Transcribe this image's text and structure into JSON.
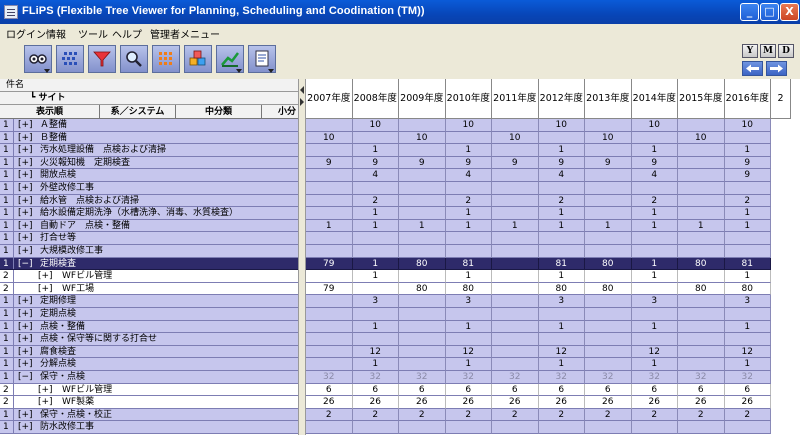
{
  "window": {
    "title": "FLiPS (Flexible Tree Viewer for Planning, Scheduling and Coodination (TM))",
    "buttons": {
      "minimize": "_",
      "maximize": "□",
      "close": "X"
    }
  },
  "menu": [
    "ログイン情報",
    "ツール",
    "ヘルプ",
    "管理者メニュー"
  ],
  "toolbar": {
    "icons": [
      "glasses-icon",
      "grid-dots-icon",
      "filter-icon",
      "search-icon",
      "orange-dots-icon",
      "cubes-icon",
      "green-chart-icon",
      "document-icon"
    ],
    "right_buttons": [
      "Y",
      "M",
      "D"
    ]
  },
  "header": {
    "item": "件名",
    "site": "┗ サイト",
    "cols": [
      "表示順",
      "系／システム",
      "中分類",
      "小分"
    ]
  },
  "years": [
    "2007年度",
    "2008年度",
    "2009年度",
    "2010年度",
    "2011年度",
    "2012年度",
    "2013年度",
    "2014年度",
    "2015年度",
    "2016年度",
    "2"
  ],
  "rows": [
    {
      "level": "1",
      "expand": "[+]",
      "name": "Ａ整備",
      "values": [
        "",
        "10",
        "",
        "10",
        "",
        "10",
        "",
        "10",
        "",
        "10"
      ],
      "style": "normal",
      "indent": 0
    },
    {
      "level": "1",
      "expand": "[+]",
      "name": "Ｂ整備",
      "values": [
        "10",
        "",
        "10",
        "",
        "10",
        "",
        "10",
        "",
        "10",
        ""
      ],
      "style": "normal",
      "indent": 0
    },
    {
      "level": "1",
      "expand": "[+]",
      "name": "汚水処理設備　点検および清掃",
      "values": [
        "",
        "1",
        "",
        "1",
        "",
        "1",
        "",
        "1",
        "",
        "1"
      ],
      "style": "normal",
      "indent": 0
    },
    {
      "level": "1",
      "expand": "[+]",
      "name": "火災報知機　定期検査",
      "values": [
        "9",
        "9",
        "9",
        "9",
        "9",
        "9",
        "9",
        "9",
        "",
        "9"
      ],
      "style": "normal",
      "indent": 0
    },
    {
      "level": "1",
      "expand": "[+]",
      "name": "開放点検",
      "values": [
        "",
        "4",
        "",
        "4",
        "",
        "4",
        "",
        "4",
        "",
        "9"
      ],
      "style": "normal",
      "indent": 0
    },
    {
      "level": "1",
      "expand": "[+]",
      "name": "外壁改修工事",
      "values": [
        "",
        "",
        "",
        "",
        "",
        "",
        "",
        "",
        "",
        ""
      ],
      "style": "normal",
      "indent": 0
    },
    {
      "level": "1",
      "expand": "[+]",
      "name": "給水管　点検および清掃",
      "values": [
        "",
        "2",
        "",
        "2",
        "",
        "2",
        "",
        "2",
        "",
        "2"
      ],
      "style": "normal",
      "indent": 0
    },
    {
      "level": "1",
      "expand": "[+]",
      "name": "給水設備定期洗浄（水槽洗浄、消毒、水質検査）",
      "values": [
        "",
        "1",
        "",
        "1",
        "",
        "1",
        "",
        "1",
        "",
        "1"
      ],
      "style": "normal",
      "indent": 0
    },
    {
      "level": "1",
      "expand": "[+]",
      "name": "自動ドア　点検・整備",
      "values": [
        "1",
        "1",
        "1",
        "1",
        "1",
        "1",
        "1",
        "1",
        "1",
        "1"
      ],
      "style": "normal",
      "indent": 0
    },
    {
      "level": "1",
      "expand": "[+]",
      "name": "打合せ等",
      "values": [
        "",
        "",
        "",
        "",
        "",
        "",
        "",
        "",
        "",
        ""
      ],
      "style": "normal",
      "indent": 0
    },
    {
      "level": "1",
      "expand": "[+]",
      "name": "大規模改修工事",
      "values": [
        "",
        "",
        "",
        "",
        "",
        "",
        "",
        "",
        "",
        ""
      ],
      "style": "normal",
      "indent": 0
    },
    {
      "level": "1",
      "expand": "[−]",
      "name": "定期検査",
      "values": [
        "79",
        "1",
        "80",
        "81",
        "",
        "81",
        "80",
        "1",
        "80",
        "81"
      ],
      "style": "selected",
      "indent": 0
    },
    {
      "level": "2",
      "expand": "[+]",
      "name": "WFビル管理",
      "values": [
        "",
        "1",
        "",
        "1",
        "",
        "1",
        "",
        "1",
        "",
        "1"
      ],
      "style": "child",
      "indent": 1
    },
    {
      "level": "2",
      "expand": "[+]",
      "name": "WF工場",
      "values": [
        "79",
        "",
        "80",
        "80",
        "",
        "80",
        "80",
        "",
        "80",
        "80"
      ],
      "style": "child",
      "indent": 1
    },
    {
      "level": "1",
      "expand": "[+]",
      "name": "定期修理",
      "values": [
        "",
        "3",
        "",
        "3",
        "",
        "3",
        "",
        "3",
        "",
        "3"
      ],
      "style": "normal",
      "indent": 0
    },
    {
      "level": "1",
      "expand": "[+]",
      "name": "定期点検",
      "values": [
        "",
        "",
        "",
        "",
        "",
        "",
        "",
        "",
        "",
        ""
      ],
      "style": "normal",
      "indent": 0
    },
    {
      "level": "1",
      "expand": "[+]",
      "name": "点検・整備",
      "values": [
        "",
        "1",
        "",
        "1",
        "",
        "1",
        "",
        "1",
        "",
        "1"
      ],
      "style": "normal",
      "indent": 0
    },
    {
      "level": "1",
      "expand": "[+]",
      "name": "点検・保守等に関する打合せ",
      "values": [
        "",
        "",
        "",
        "",
        "",
        "",
        "",
        "",
        "",
        ""
      ],
      "style": "normal",
      "indent": 0
    },
    {
      "level": "1",
      "expand": "[+]",
      "name": "腐食検査",
      "values": [
        "",
        "12",
        "",
        "12",
        "",
        "12",
        "",
        "12",
        "",
        "12"
      ],
      "style": "normal",
      "indent": 0
    },
    {
      "level": "1",
      "expand": "[+]",
      "name": "分解点検",
      "values": [
        "",
        "1",
        "",
        "1",
        "",
        "1",
        "",
        "1",
        "",
        "1"
      ],
      "style": "normal",
      "indent": 0
    },
    {
      "level": "1",
      "expand": "[−]",
      "name": "保守・点検",
      "values": [
        "32",
        "32",
        "32",
        "32",
        "32",
        "32",
        "32",
        "32",
        "32",
        "32"
      ],
      "style": "normal dim",
      "indent": 0
    },
    {
      "level": "2",
      "expand": "[+]",
      "name": "WFビル管理",
      "values": [
        "6",
        "6",
        "6",
        "6",
        "6",
        "6",
        "6",
        "6",
        "6",
        "6"
      ],
      "style": "child",
      "indent": 1
    },
    {
      "level": "2",
      "expand": "[+]",
      "name": "WF製薬",
      "values": [
        "26",
        "26",
        "26",
        "26",
        "26",
        "26",
        "26",
        "26",
        "26",
        "26"
      ],
      "style": "child",
      "indent": 1
    },
    {
      "level": "1",
      "expand": "[+]",
      "name": "保守・点検・校正",
      "values": [
        "2",
        "2",
        "2",
        "2",
        "2",
        "2",
        "2",
        "2",
        "2",
        "2"
      ],
      "style": "normal",
      "indent": 0
    },
    {
      "level": "1",
      "expand": "[+]",
      "name": "防水改修工事",
      "values": [
        "",
        "",
        "",
        "",
        "",
        "",
        "",
        "",
        "",
        ""
      ],
      "style": "normal",
      "indent": 0
    }
  ]
}
